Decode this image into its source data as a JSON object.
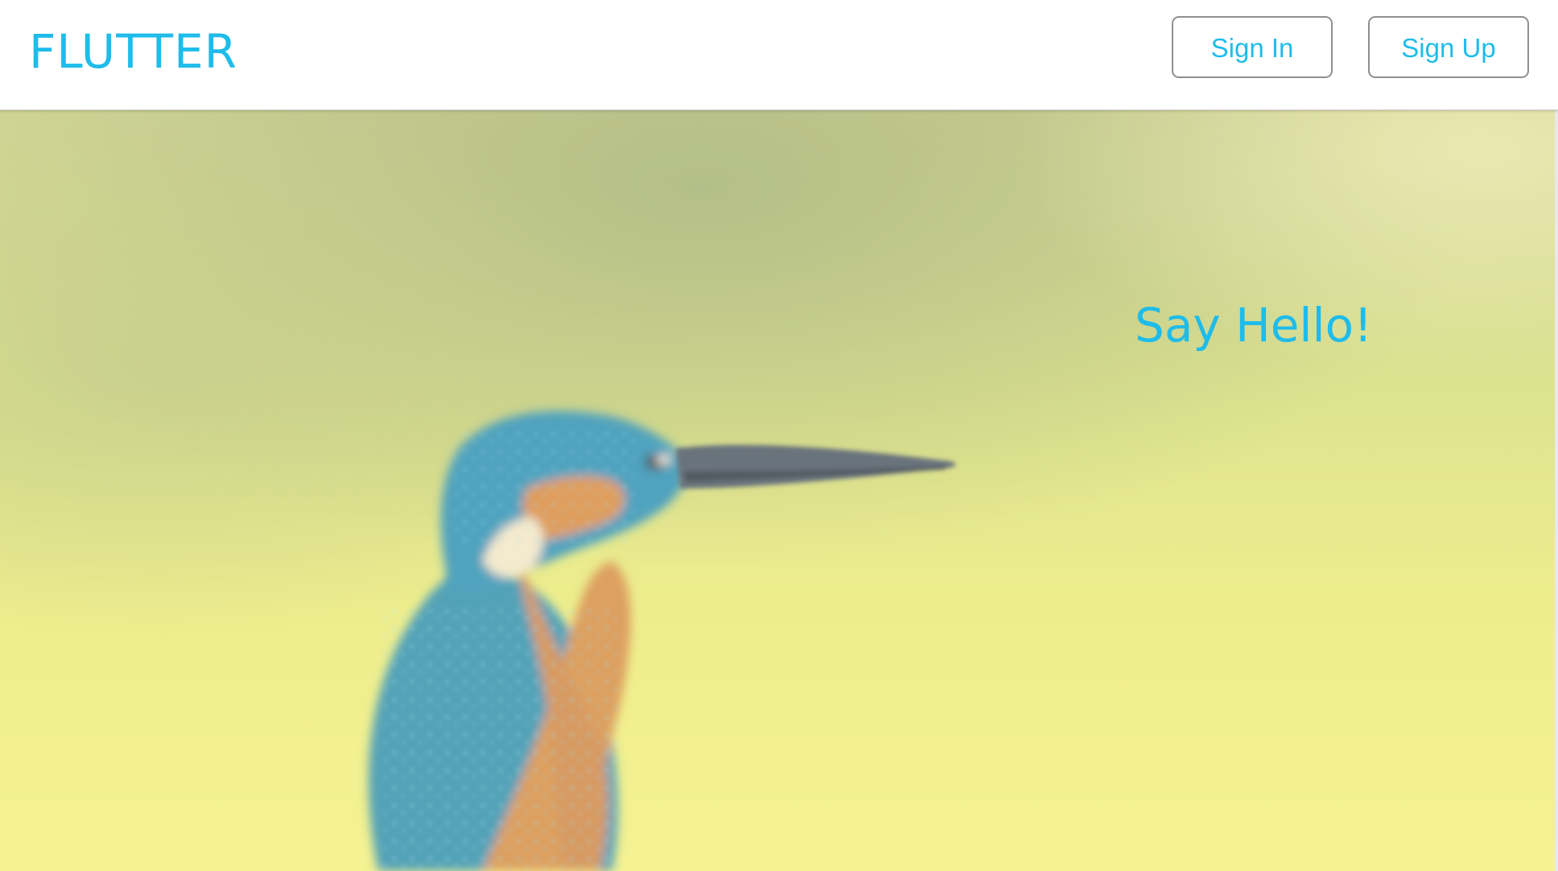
{
  "header": {
    "brand": "FLUTTER",
    "sign_in_label": "Sign In",
    "sign_up_label": "Sign Up"
  },
  "hero": {
    "tagline": "Say Hello!",
    "image": "kingfisher-photo"
  },
  "colors": {
    "accent": "#1ebcea",
    "header_bg": "#ffffff",
    "button_border": "#8f8f8f"
  }
}
